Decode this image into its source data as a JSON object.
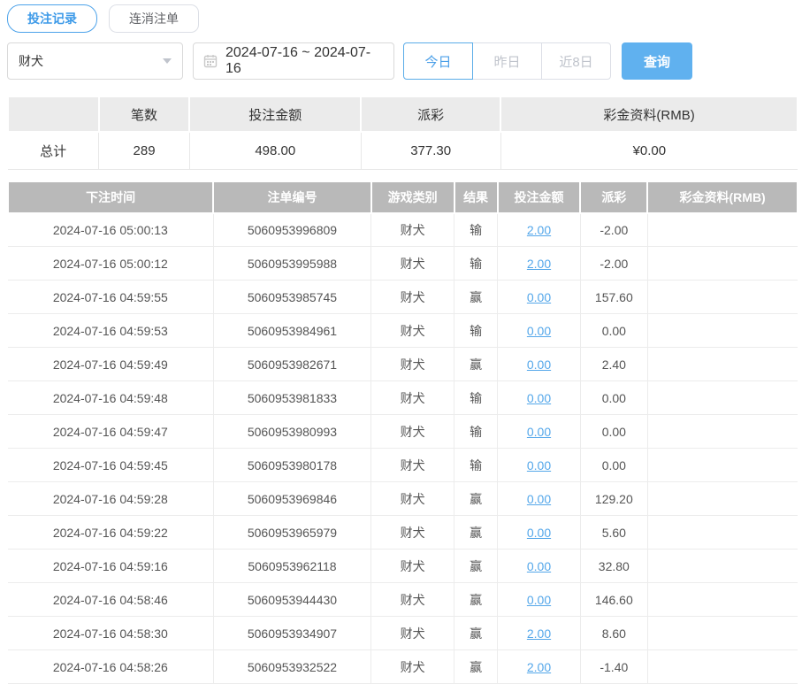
{
  "tabs": [
    {
      "label": "投注记录",
      "active": true
    },
    {
      "label": "连消注单",
      "active": false
    }
  ],
  "filters": {
    "game_select": {
      "value": "财犬"
    },
    "date_range": "2024-07-16 ~ 2024-07-16",
    "quick_buttons": [
      {
        "label": "今日",
        "active": true
      },
      {
        "label": "昨日",
        "active": false
      },
      {
        "label": "近8日",
        "active": false
      }
    ],
    "search_label": "查询"
  },
  "summary": {
    "headers": [
      "",
      "笔数",
      "投注金额",
      "派彩",
      "彩金资料(RMB)"
    ],
    "total": {
      "label": "总计",
      "count": "289",
      "amount": "498.00",
      "payout": "377.30",
      "bonus": "¥0.00"
    }
  },
  "table": {
    "headers": [
      "下注时间",
      "注单编号",
      "游戏类别",
      "结果",
      "投注金额",
      "派彩",
      "彩金资料(RMB)"
    ],
    "rows": [
      {
        "time": "2024-07-16 05:00:13",
        "order": "5060953996809",
        "game": "财犬",
        "result": "输",
        "amount": "2.00",
        "payout": "-2.00",
        "bonus": ""
      },
      {
        "time": "2024-07-16 05:00:12",
        "order": "5060953995988",
        "game": "财犬",
        "result": "输",
        "amount": "2.00",
        "payout": "-2.00",
        "bonus": ""
      },
      {
        "time": "2024-07-16 04:59:55",
        "order": "5060953985745",
        "game": "财犬",
        "result": "赢",
        "amount": "0.00",
        "payout": "157.60",
        "bonus": ""
      },
      {
        "time": "2024-07-16 04:59:53",
        "order": "5060953984961",
        "game": "财犬",
        "result": "输",
        "amount": "0.00",
        "payout": "0.00",
        "bonus": ""
      },
      {
        "time": "2024-07-16 04:59:49",
        "order": "5060953982671",
        "game": "财犬",
        "result": "赢",
        "amount": "0.00",
        "payout": "2.40",
        "bonus": ""
      },
      {
        "time": "2024-07-16 04:59:48",
        "order": "5060953981833",
        "game": "财犬",
        "result": "输",
        "amount": "0.00",
        "payout": "0.00",
        "bonus": ""
      },
      {
        "time": "2024-07-16 04:59:47",
        "order": "5060953980993",
        "game": "财犬",
        "result": "输",
        "amount": "0.00",
        "payout": "0.00",
        "bonus": ""
      },
      {
        "time": "2024-07-16 04:59:45",
        "order": "5060953980178",
        "game": "财犬",
        "result": "输",
        "amount": "0.00",
        "payout": "0.00",
        "bonus": ""
      },
      {
        "time": "2024-07-16 04:59:28",
        "order": "5060953969846",
        "game": "财犬",
        "result": "赢",
        "amount": "0.00",
        "payout": "129.20",
        "bonus": ""
      },
      {
        "time": "2024-07-16 04:59:22",
        "order": "5060953965979",
        "game": "财犬",
        "result": "赢",
        "amount": "0.00",
        "payout": "5.60",
        "bonus": ""
      },
      {
        "time": "2024-07-16 04:59:16",
        "order": "5060953962118",
        "game": "财犬",
        "result": "赢",
        "amount": "0.00",
        "payout": "32.80",
        "bonus": ""
      },
      {
        "time": "2024-07-16 04:58:46",
        "order": "5060953944430",
        "game": "财犬",
        "result": "赢",
        "amount": "0.00",
        "payout": "146.60",
        "bonus": ""
      },
      {
        "time": "2024-07-16 04:58:30",
        "order": "5060953934907",
        "game": "财犬",
        "result": "赢",
        "amount": "2.00",
        "payout": "8.60",
        "bonus": ""
      },
      {
        "time": "2024-07-16 04:58:26",
        "order": "5060953932522",
        "game": "财犬",
        "result": "赢",
        "amount": "2.00",
        "payout": "-1.40",
        "bonus": ""
      }
    ]
  },
  "colors": {
    "accent_blue": "#4da3ea",
    "link_blue": "#54a7ea",
    "button_blue": "#60b1ef",
    "negative_red": "#e05c5c",
    "table_header_gray": "#b9b9b9",
    "summary_header_gray": "#ebebeb"
  },
  "icons": {
    "calendar": "calendar-icon",
    "caret": "chevron-down-icon"
  }
}
